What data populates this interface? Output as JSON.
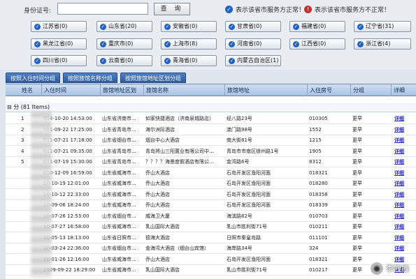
{
  "search": {
    "id_label": "身份证号:",
    "id_value": "",
    "button_label": "查 询"
  },
  "legend": {
    "normal_label": "表示该省市服务方正常！",
    "abnormal_label": "表示该省市服务方不正常！"
  },
  "provinces": [
    {
      "label": "江苏省(0)"
    },
    {
      "label": "山东省(20)"
    },
    {
      "label": "安徽省(0)"
    },
    {
      "label": "甘肃省(0)"
    },
    {
      "label": "福建省(0)"
    },
    {
      "label": "辽宁省(31)"
    },
    {
      "label": "黑龙江省(0)"
    },
    {
      "label": "重庆市(0)"
    },
    {
      "label": "上海市(8)"
    },
    {
      "label": "河南省(0)"
    },
    {
      "label": "江西省(0)"
    },
    {
      "label": "浙江省(4)"
    },
    {
      "label": "四川省(0)"
    },
    {
      "label": "云南省(0)"
    },
    {
      "label": "青海省(0)"
    },
    {
      "label": "内蒙古自治区(1)"
    }
  ],
  "tabs": [
    {
      "label": "按照入住时间分组"
    },
    {
      "label": "按照旅馆名称分组"
    },
    {
      "label": "按照旅馆地址区划分组"
    }
  ],
  "table": {
    "columns": [
      "姓名",
      "入住时间",
      "旅馆地址区划",
      "旅馆名称",
      "旅馆地址",
      "入住房号",
      "分组",
      "详细"
    ],
    "group_label": "分 (81 Items)",
    "detail_text": "详细",
    "rows": [
      {
        "no": "1",
        "time": "014-10-20 14:53:00",
        "area": "山东省济南市...",
        "hotel": "如家快捷酒店（济南泉城路店）",
        "addr": "经八路23号",
        "room": "010305",
        "group": "更早"
      },
      {
        "no": "2",
        "time": "011-09-22 17:25:00",
        "area": "山东省青岛市...",
        "hotel": "海尔洲际酒店",
        "addr": "澳门路98号",
        "room": "1552",
        "group": "更早"
      },
      {
        "no": "3",
        "time": "011-07-21 17:18:00",
        "area": "山东省烟台市...",
        "hotel": "烟台中心大酒店",
        "addr": "南大街81号",
        "room": "1215",
        "group": "更早"
      },
      {
        "no": "4",
        "time": "011-07-21 09:35:00",
        "area": "山东省青岛市...",
        "hotel": "青岛将山三阳置业有限公司中...",
        "addr": "青岛市市南区徐州路1号",
        "room": "1905",
        "group": "更早"
      },
      {
        "no": "5",
        "time": "011-07-19 15:30:00",
        "area": "山东省青岛市...",
        "hotel": "？？？？海景度假酒店有限公...",
        "addr": "金湾路6号",
        "room": "8312",
        "group": "更早"
      },
      {
        "no": "",
        "time": "010-12-09 16:59:00",
        "area": "山东省威海市...",
        "hotel": "乔山大酒店",
        "addr": "石岛开发区渔阳河面",
        "room": "018321",
        "group": "更早"
      },
      {
        "no": "",
        "time": "10-10-19 12:01:00",
        "area": "山东省威海市...",
        "hotel": "乔山大酒店",
        "addr": "石岛开发区渔阳河面",
        "room": "018280",
        "group": "更早"
      },
      {
        "no": "",
        "time": "10-10-12 22:33:00",
        "area": "山东省威海市...",
        "hotel": "乔山大酒店",
        "addr": "石岛开发区渔阳河面",
        "room": "018358",
        "group": "更早"
      },
      {
        "no": "",
        "time": "10-09-06 18:24:00",
        "area": "山东省威海市...",
        "hotel": "乔山大酒店",
        "addr": "石岛开发区渔阳河面",
        "room": "018339",
        "group": "更早"
      },
      {
        "no": "",
        "time": "10-07-26 12:53:00",
        "area": "山东省烟台市...",
        "hotel": "威海卫大厦",
        "addr": "海滨路82号",
        "room": "010703",
        "group": "更早"
      },
      {
        "no": "",
        "time": "10-07-27 16:58:00",
        "area": "山东省威海市...",
        "hotel": "乳山国际大酒店",
        "addr": "乳山市胜利街71号",
        "room": "010211",
        "group": "更早"
      },
      {
        "no": "",
        "time": "10-05-13 18:13:00",
        "area": "山东省日照市...",
        "hotel": "德海大酒店",
        "addr": "日照市秦皇岛路",
        "room": "011101",
        "group": "更早"
      },
      {
        "no": "",
        "time": "10-03-24 22:36:00",
        "area": "山东省烟台市...",
        "hotel": "金海湾大酒店（烟台山宾馆）",
        "addr": "海岸路34号",
        "room": "324",
        "group": "更早"
      },
      {
        "no": "",
        "time": "10-01-26 12:16:00",
        "area": "山东省威海市...",
        "hotel": "乔山大酒店",
        "addr": "石岛开发区渔阳河面",
        "room": "018321",
        "group": "更早"
      },
      {
        "no": "",
        "time": "2009-09-22 18:29:00",
        "area": "山东省威海市...",
        "hotel": "乳山国际大酒店",
        "addr": "乳山市胜利街71号",
        "room": "010217",
        "group": "更早"
      }
    ]
  },
  "watermark": {
    "text": "李拽拽"
  }
}
